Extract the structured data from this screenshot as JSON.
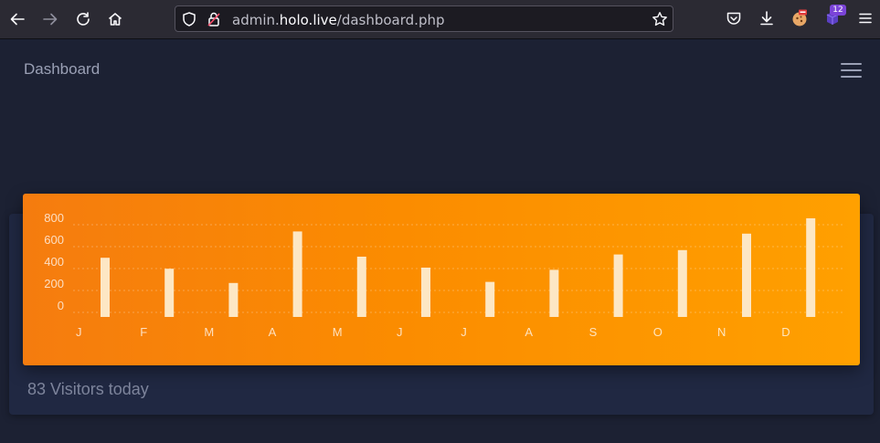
{
  "browser": {
    "url_prefix": "admin.",
    "url_host": "holo.live",
    "url_path": "/dashboard.php",
    "extension_badge": "12"
  },
  "page": {
    "title": "Dashboard",
    "visitors_text": "83 Visitors today"
  },
  "chart_data": {
    "type": "bar",
    "categories": [
      "J",
      "F",
      "M",
      "A",
      "M",
      "J",
      "J",
      "A",
      "S",
      "O",
      "N",
      "D"
    ],
    "values": [
      540,
      440,
      310,
      780,
      550,
      450,
      320,
      430,
      570,
      610,
      760,
      900
    ],
    "yticks": [
      "800",
      "600",
      "400",
      "200",
      "0"
    ],
    "ylim": [
      0,
      900
    ],
    "grid": true,
    "bar_color": "#fde7c4",
    "grid_color": "#ffffff"
  }
}
